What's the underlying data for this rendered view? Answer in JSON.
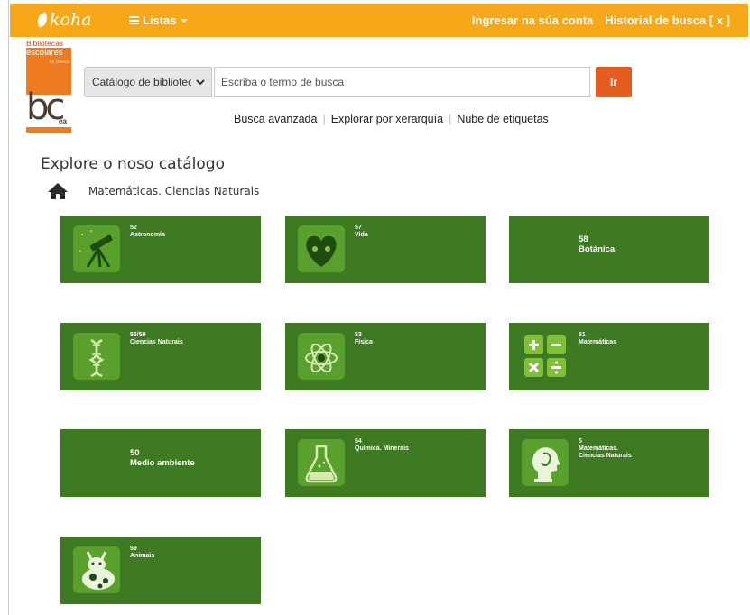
{
  "navbar": {
    "logo": "koha",
    "lists_label": "Listas",
    "login_label": "Ingresar na súa conta",
    "history_label": "Historial de busca [ x ]"
  },
  "library_logo": {
    "line1": "Bibliotecas",
    "line2": "escolares",
    "line3": "de Galicia",
    "mark": "bc",
    "mark_suffix": "ea"
  },
  "search": {
    "catalog_select": "Catálogo de bibliotecas",
    "placeholder": "Escriba o termo de busca",
    "go_label": "Ir"
  },
  "search_links": {
    "advanced": "Busca avanzada",
    "hierarchy": "Explorar por xerarquía",
    "tags": "Nube de etiquetas"
  },
  "page": {
    "title": "Explore o noso catálogo",
    "breadcrumb": "Matemáticas. Ciencias Naturais"
  },
  "tiles": [
    {
      "num": "52",
      "label": "Astronomía",
      "icon": "telescope-icon"
    },
    {
      "num": "57",
      "label": "Vida",
      "icon": "heart-face-icon"
    },
    {
      "num": "58",
      "label": "Botánica",
      "icon": ""
    },
    {
      "num": "55/59",
      "label": "Ciencias Naturais",
      "icon": "dna-icon"
    },
    {
      "num": "53",
      "label": "Física",
      "icon": "atom-icon"
    },
    {
      "num": "51",
      "label": "Matemáticas",
      "icon": "math-operators-icon"
    },
    {
      "num": "50",
      "label": "Medio ambiente",
      "icon": ""
    },
    {
      "num": "54",
      "label": "Química. Minerais",
      "icon": "flask-icon"
    },
    {
      "num": "5",
      "label": "Matemáticas. Ciencias Naturais",
      "icon": "head-profile-icon"
    },
    {
      "num": "59",
      "label": "Animais",
      "icon": "cow-icon"
    }
  ]
}
